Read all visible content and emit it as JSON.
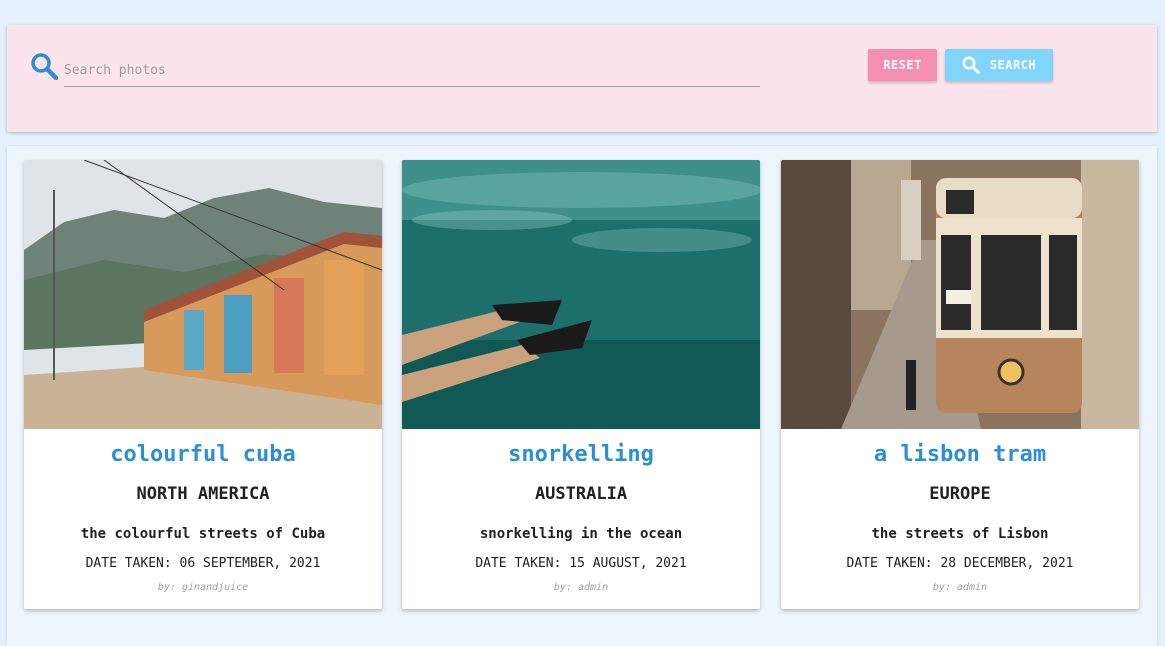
{
  "search": {
    "placeholder": "Search photos",
    "reset_label": "RESET",
    "search_label": "SEARCH"
  },
  "colors": {
    "background": "#e3f1fc",
    "search_panel": "#fce4ec",
    "reset_button": "#f48fb1",
    "search_button": "#81d4fa",
    "search_icon": "#2b8ed6",
    "title_text": "#2b8ed6"
  },
  "cards": [
    {
      "title": "colourful cuba",
      "region": "NORTH AMERICA",
      "description": "the colourful streets of Cuba",
      "date": "DATE TAKEN: 06 SEPTEMBER, 2021",
      "author": "by: ginandjuice",
      "image_icon": "street-photo"
    },
    {
      "title": "snorkelling",
      "region": "AUSTRALIA",
      "description": "snorkelling in the ocean",
      "date": "DATE TAKEN: 15 AUGUST, 2021",
      "author": "by: admin",
      "image_icon": "underwater-photo"
    },
    {
      "title": "a lisbon tram",
      "region": "EUROPE",
      "description": "the streets of Lisbon",
      "date": "DATE TAKEN: 28 DECEMBER, 2021",
      "author": "by: admin",
      "image_icon": "tram-photo"
    }
  ]
}
